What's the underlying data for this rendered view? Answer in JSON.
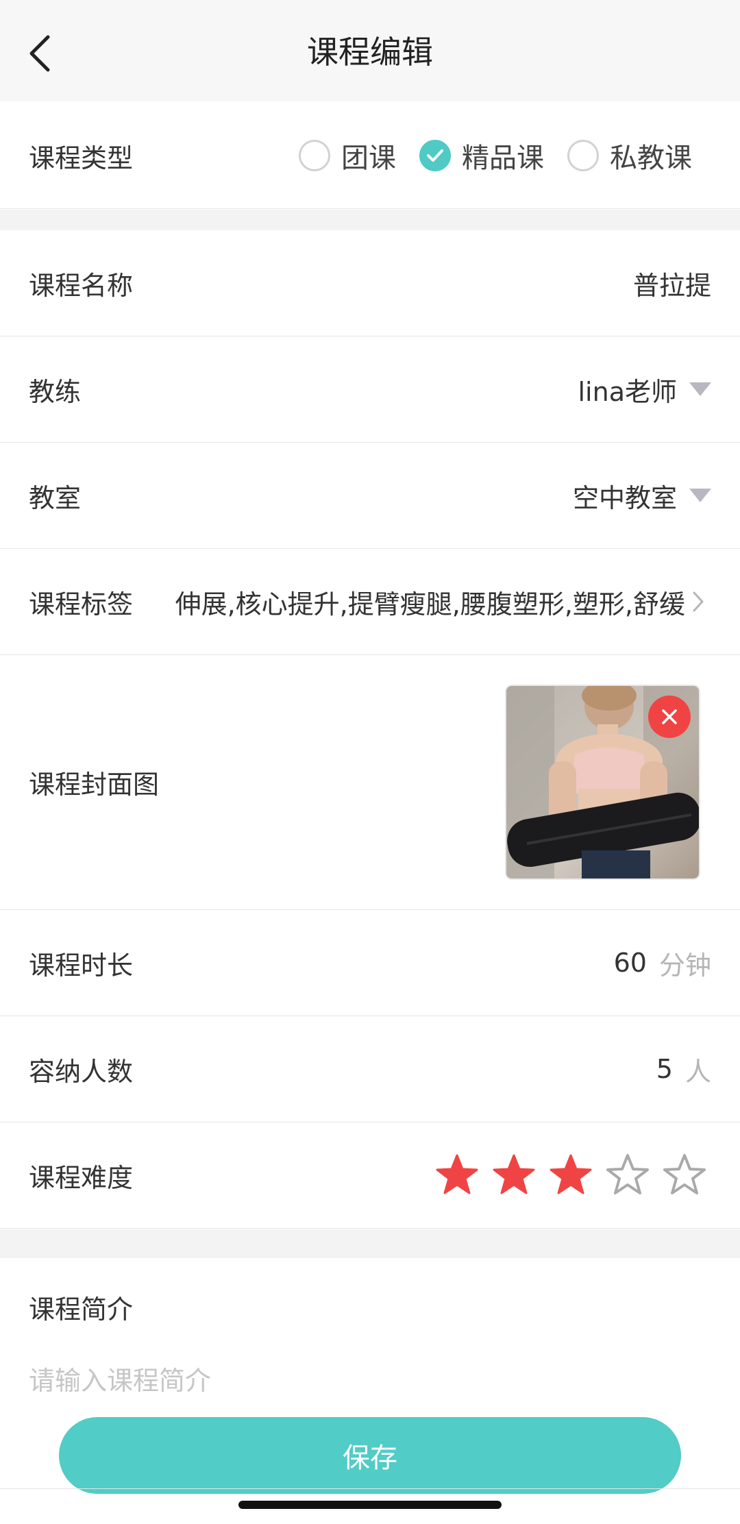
{
  "header": {
    "title": "课程编辑"
  },
  "course_type": {
    "label": "课程类型",
    "options": [
      {
        "label": "团课",
        "checked": false
      },
      {
        "label": "精品课",
        "checked": true
      },
      {
        "label": "私教课",
        "checked": false
      }
    ]
  },
  "course_name": {
    "label": "课程名称",
    "value": "普拉提"
  },
  "coach": {
    "label": "教练",
    "value": "lina老师"
  },
  "classroom": {
    "label": "教室",
    "value": "空中教室"
  },
  "tags": {
    "label": "课程标签",
    "value": "伸展,核心提升,提臂瘦腿,腰腹塑形,塑形,舒缓"
  },
  "cover": {
    "label": "课程封面图"
  },
  "duration": {
    "label": "课程时长",
    "value": "60",
    "unit": "分钟"
  },
  "capacity": {
    "label": "容纳人数",
    "value": "5",
    "unit": "人"
  },
  "difficulty": {
    "label": "课程难度",
    "rating": 3,
    "max": 5
  },
  "intro": {
    "label": "课程简介",
    "placeholder": "请输入课程简介"
  },
  "save_button": {
    "label": "保存"
  },
  "colors": {
    "accent": "#51ccc6",
    "star_active": "#f04444",
    "delete_badge": "#f04444"
  }
}
